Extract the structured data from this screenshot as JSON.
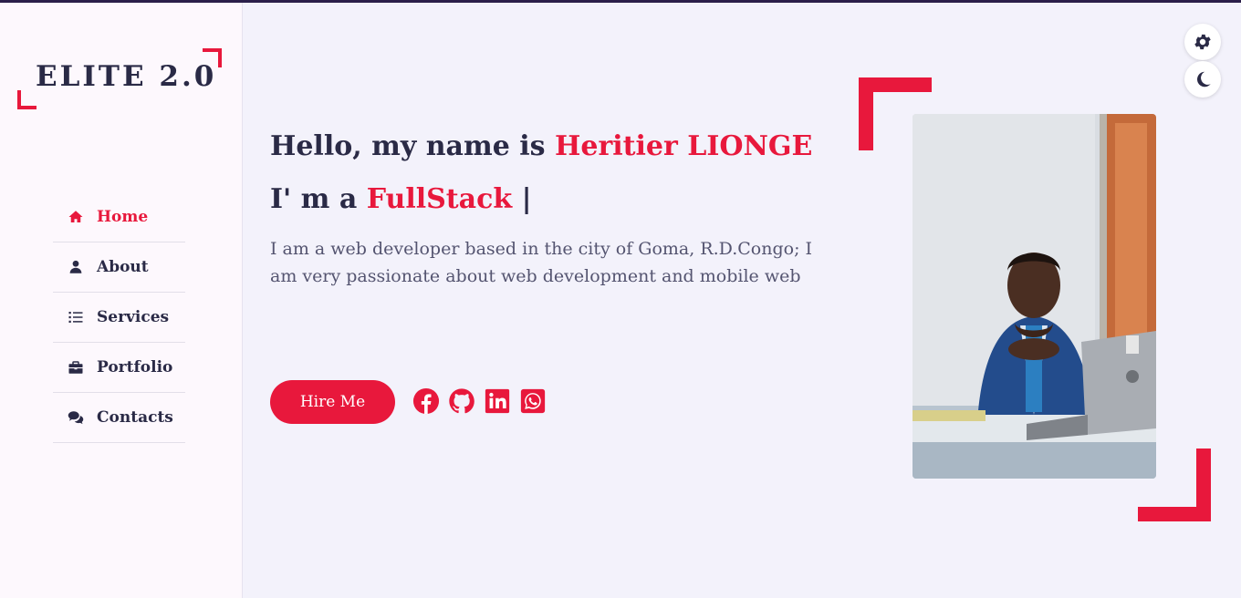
{
  "brand": {
    "logo": "ELITE 2.0"
  },
  "nav": {
    "items": [
      {
        "label": "Home",
        "icon": "home-icon",
        "active": true
      },
      {
        "label": "About",
        "icon": "user-icon",
        "active": false
      },
      {
        "label": "Services",
        "icon": "list-icon",
        "active": false
      },
      {
        "label": "Portfolio",
        "icon": "briefcase-icon",
        "active": false
      },
      {
        "label": "Contacts",
        "icon": "comments-icon",
        "active": false
      }
    ]
  },
  "hero": {
    "greeting": "Hello, my name is",
    "name": "Heritier LIONGE",
    "role_prefix": "I' m a",
    "role": "FullStack",
    "cursor": "|",
    "bio": "I am a web developer based in the city of Goma, R.D.Congo; I am very passionate about web development and mobile web",
    "cta": "Hire Me"
  },
  "socials": [
    "facebook-icon",
    "github-icon",
    "linkedin-icon",
    "whatsapp-icon"
  ],
  "controls": [
    "settings-gear-icon",
    "dark-mode-moon-icon"
  ],
  "colors": {
    "accent": "#e8183c",
    "text": "#2a2a46",
    "background": "#f3f2fb",
    "sidebar": "#fdf8fd"
  }
}
